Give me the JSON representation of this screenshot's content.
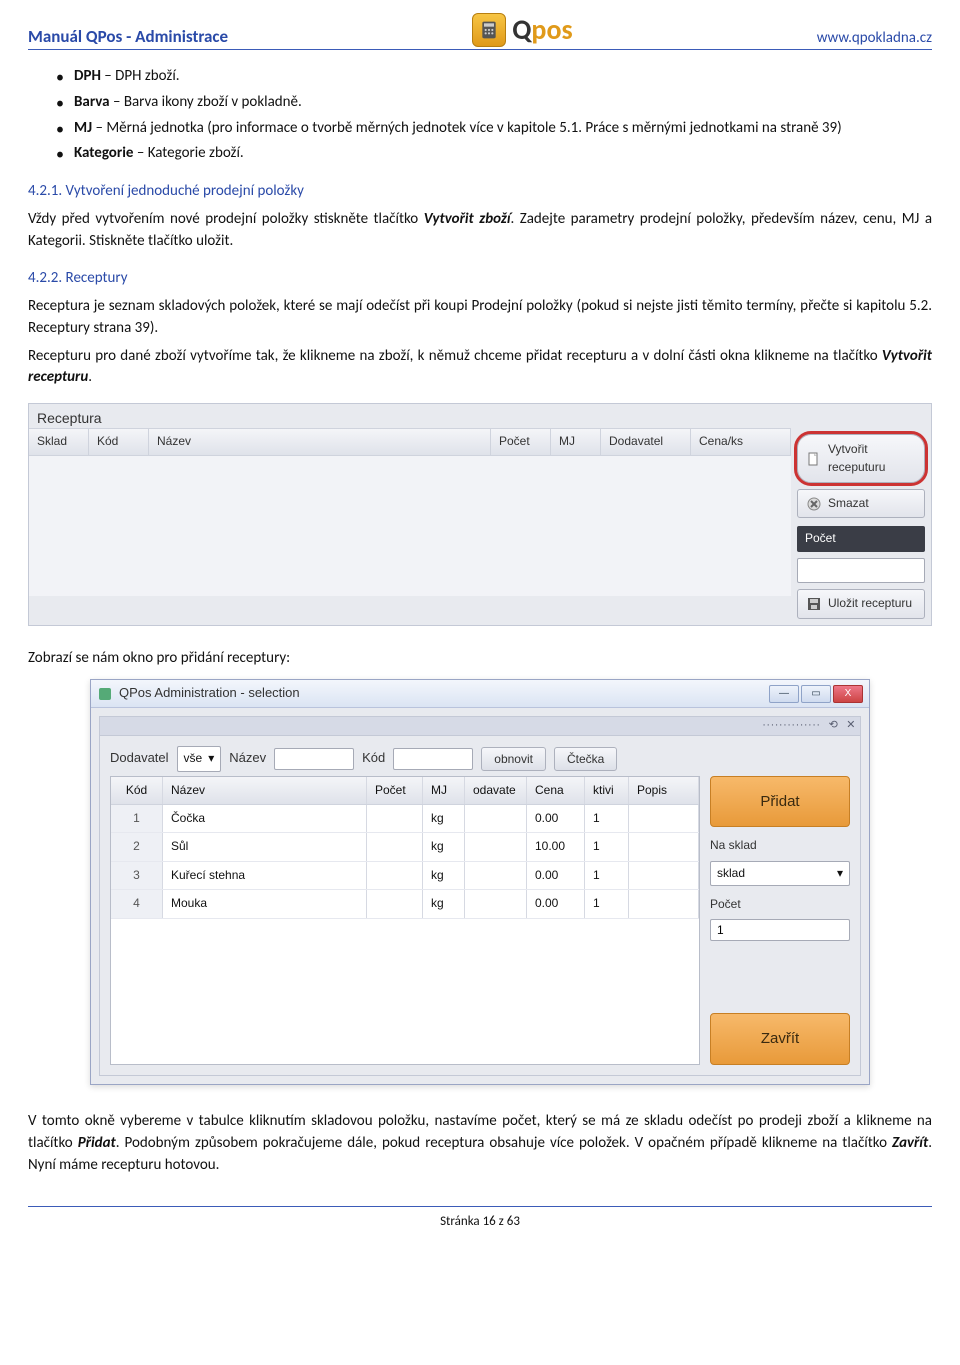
{
  "header": {
    "left": "Manuál QPos - Administrace",
    "logo_text_1": "Q",
    "logo_text_2": "pos",
    "right": "www.qpokladna.cz"
  },
  "bullets": [
    {
      "b": "DPH",
      "t": " – DPH zboží."
    },
    {
      "b": "Barva",
      "t": " – Barva ikony zboží v pokladně."
    },
    {
      "b": "MJ",
      "t": " – Měrná jednotka (pro informace o tvorbě měrných jednotek více v kapitole 5.1. Práce s měrnými jednotkami na straně 39)"
    },
    {
      "b": "Kategorie",
      "t": " – Kategorie zboží."
    }
  ],
  "sec1": {
    "h": "4.2.1. Vytvoření jednoduché prodejní položky",
    "p1a": "Vždy před vytvořením nové prodejní položky stiskněte tlačítko ",
    "p1b": "Vytvořit zboží",
    "p1c": ". Zadejte parametry prodejní položky, především název, cenu, MJ a Kategorii. Stiskněte tlačítko uložit."
  },
  "sec2": {
    "h": "4.2.2. Receptury",
    "p1": "Receptura je seznam skladových položek, které se mají odečíst při koupi Prodejní položky (pokud si nejste jisti těmito termíny, přečte si kapitolu 5.2. Receptury strana 39).",
    "p2a": "Recepturu pro dané zboží vytvoříme tak, že klikneme na zboží, k němuž chceme přidat recepturu a v dolní části okna klikneme na tlačítko ",
    "p2b": "Vytvořit recepturu",
    "p2c": "."
  },
  "shot1": {
    "title": "Receptura",
    "cols": {
      "sklad": "Sklad",
      "kod": "Kód",
      "nazev": "Název",
      "pocet": "Počet",
      "mj": "MJ",
      "dodavatel": "Dodavatel",
      "cena": "Cena/ks"
    },
    "btn_create_line1": "Vytvořit",
    "btn_create_line2": "receputuru",
    "btn_delete": "Smazat",
    "lbl_pocet": "Počet",
    "btn_save": "Uložit recepturu"
  },
  "p_after1": "Zobrazí se nám okno pro přidání receptury:",
  "shot2": {
    "title": "QPos Administration - selection",
    "win": {
      "min": "—",
      "max": "▭",
      "close": "X",
      "mini_dot": "··············",
      "mini_rest": "⟲",
      "mini_x": "✕"
    },
    "toolbar": {
      "dodavatel_lbl": "Dodavatel",
      "dodavatel_val": "vše",
      "nazev_lbl": "Název",
      "kod_lbl": "Kód",
      "obnovit": "obnovit",
      "ctecka": "Čtečka"
    },
    "cols": {
      "kod": "Kód",
      "nazev": "Název",
      "pocet": "Počet",
      "mj": "MJ",
      "odavatel": "odavate",
      "cena": "Cena",
      "aktiv": "ktivi",
      "popis": "Popis"
    },
    "rows": [
      {
        "kod": "1",
        "nazev": "Čočka",
        "pocet": "",
        "mj": "kg",
        "odav": "",
        "cena": "0.00",
        "akt": "1",
        "popis": ""
      },
      {
        "kod": "2",
        "nazev": "Sůl",
        "pocet": "",
        "mj": "kg",
        "odav": "",
        "cena": "10.00",
        "akt": "1",
        "popis": ""
      },
      {
        "kod": "3",
        "nazev": "Kuřecí stehna",
        "pocet": "",
        "mj": "kg",
        "odav": "",
        "cena": "0.00",
        "akt": "1",
        "popis": ""
      },
      {
        "kod": "4",
        "nazev": "Mouka",
        "pocet": "",
        "mj": "kg",
        "odav": "",
        "cena": "0.00",
        "akt": "1",
        "popis": ""
      }
    ],
    "side": {
      "pridat": "Přidat",
      "nasklad_lbl": "Na sklad",
      "nasklad_val": "sklad",
      "pocet_lbl": "Počet",
      "pocet_val": "1",
      "zavrit": "Zavřít"
    }
  },
  "p_after2a": "V tomto okně vybereme v tabulce kliknutím skladovou položku, nastavíme počet, který se má ze skladu odečíst po prodeji zboží a klikneme na tlačítko ",
  "p_after2b": "Přidat",
  "p_after2c": ". Podobným způsobem pokračujeme dále, pokud receptura obsahuje více položek. V opačném případě klikneme na tlačítko ",
  "p_after2d": "Zavřít",
  "p_after2e": ". Nyní máme recepturu hotovou.",
  "footer": "Stránka 16 z 63"
}
